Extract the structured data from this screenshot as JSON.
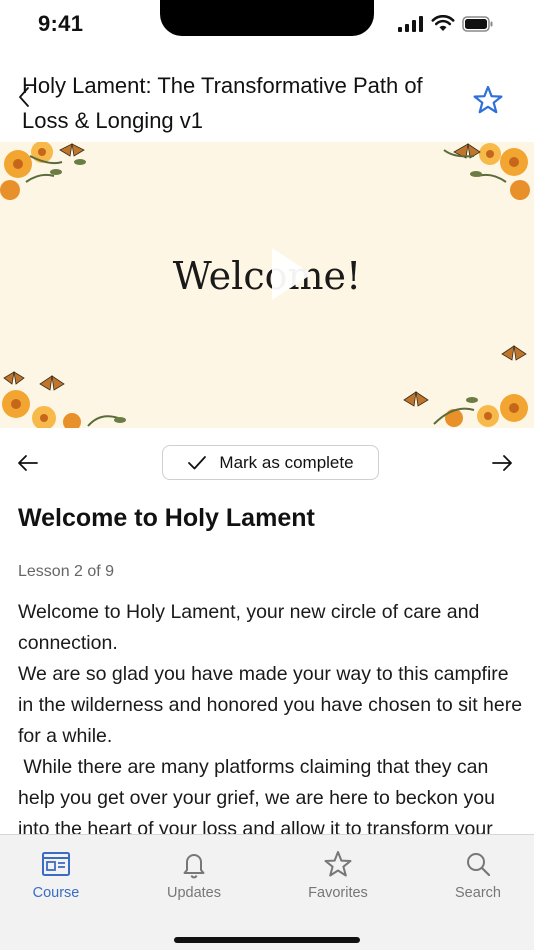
{
  "status_bar": {
    "time": "9:41"
  },
  "header": {
    "title": "Holy Lament: The Transformative Path of Loss & Longing v1"
  },
  "video": {
    "title_text": "Welcome!"
  },
  "lesson_nav": {
    "mark_complete_label": "Mark as complete"
  },
  "lesson": {
    "title": "Welcome to Holy Lament",
    "count": "Lesson 2 of 9",
    "paragraphs": [
      "Welcome to Holy Lament, your new circle of care and connection.",
      "We are so glad you have made your way to this campfire in the wilderness and honored you have chosen to sit here for a while.",
      " While there are many platforms claiming that they can help you get over your grief, we are here to beckon you into the heart of your loss and allow it to transform your"
    ]
  },
  "tab_bar": {
    "tabs": [
      {
        "label": "Course",
        "icon": "course-icon"
      },
      {
        "label": "Updates",
        "icon": "bell-icon"
      },
      {
        "label": "Favorites",
        "icon": "star-icon"
      },
      {
        "label": "Search",
        "icon": "search-icon"
      }
    ],
    "active": "Course"
  },
  "colors": {
    "accent": "#3b6cc4",
    "star": "#2f6fd8",
    "video_bg": "#fdf6e4",
    "tab_bg": "#f2f2f2"
  }
}
